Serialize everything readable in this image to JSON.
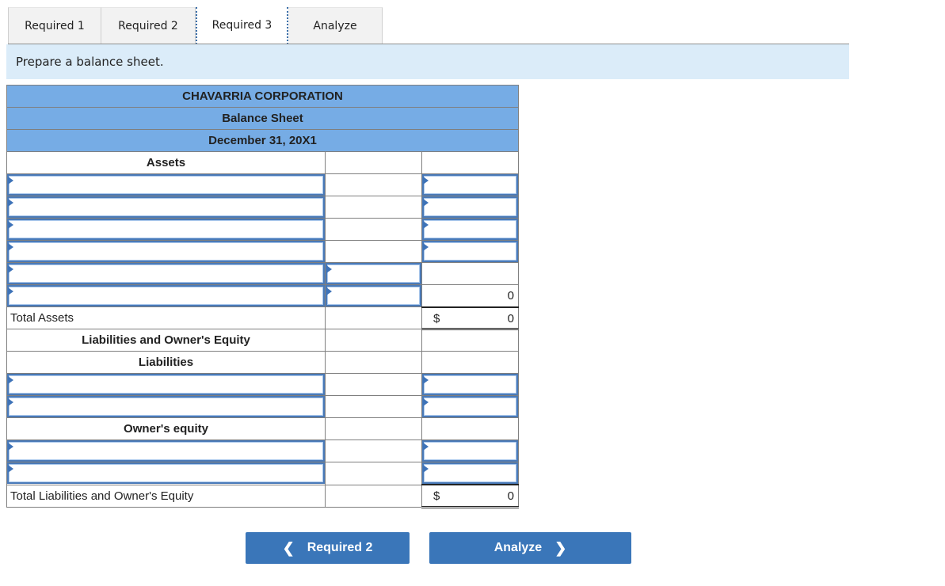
{
  "tabs": [
    {
      "label": "Required 1",
      "active": false
    },
    {
      "label": "Required 2",
      "active": false
    },
    {
      "label": "Required 3",
      "active": true
    },
    {
      "label": "Analyze",
      "active": false
    }
  ],
  "instruction": "Prepare a balance sheet.",
  "balance_sheet": {
    "company": "CHAVARRIA CORPORATION",
    "title": "Balance Sheet",
    "date": "December 31, 20X1",
    "assets_heading": "Assets",
    "total_assets_label": "Total Assets",
    "subtotal_value": "0",
    "total_assets_currency": "$",
    "total_assets_value": "0",
    "liab_equity_heading": "Liabilities and Owner's Equity",
    "liabilities_heading": "Liabilities",
    "equity_heading": "Owner's equity",
    "total_liab_equity_label": "Total Liabilities and Owner's Equity",
    "total_liab_equity_currency": "$",
    "total_liab_equity_value": "0"
  },
  "nav": {
    "prev_label": "Required 2",
    "next_label": "Analyze"
  },
  "icons": {
    "prev": "chevron-left-icon",
    "next": "chevron-right-icon",
    "dropdown_flag": "dropdown-flag-icon"
  },
  "colors": {
    "header_blue": "#76ace5",
    "instruction_bg": "#dbecf9",
    "button_blue": "#3a76b9",
    "input_border": "#4a7ab8"
  }
}
